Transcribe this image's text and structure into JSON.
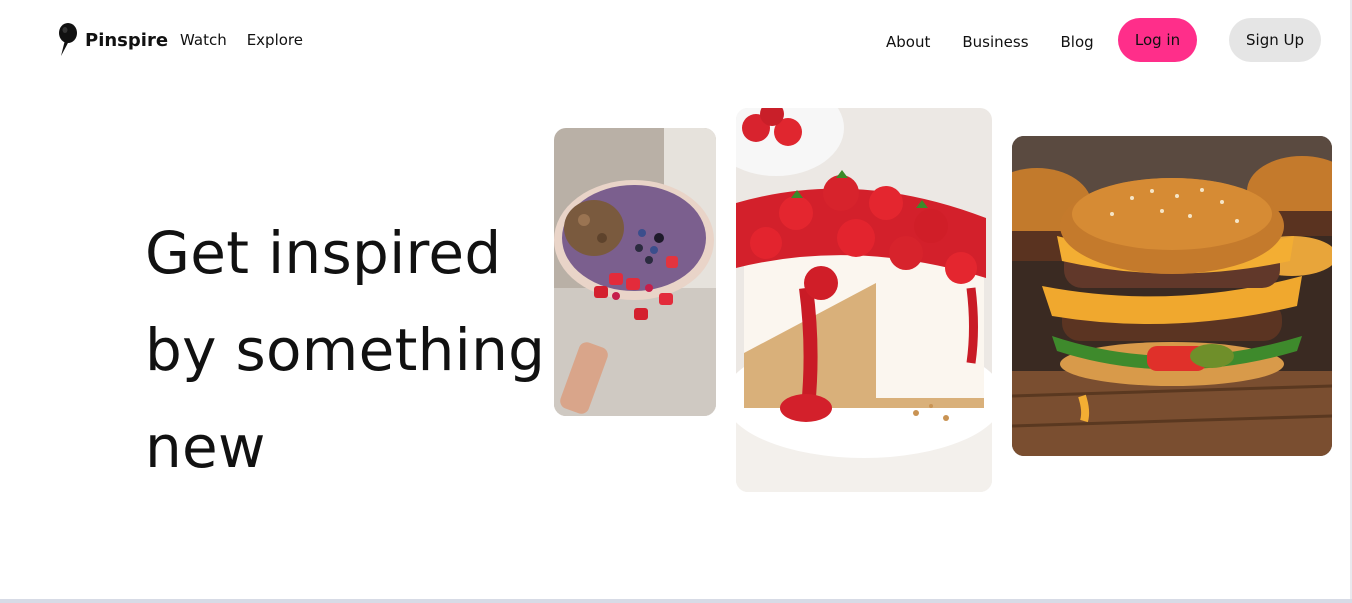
{
  "brand": {
    "name": "Pinspire",
    "icon": "pin-icon"
  },
  "nav": {
    "left": [
      "Watch",
      "Explore"
    ],
    "right": [
      "About",
      "Business",
      "Blog"
    ]
  },
  "auth": {
    "login_label": "Log in",
    "signup_label": "Sign Up"
  },
  "hero": {
    "lines": [
      "Get inspired",
      "by something",
      "new"
    ]
  },
  "images": [
    {
      "subject": "acai-bowl-with-berries"
    },
    {
      "subject": "strawberry-cheesecake"
    },
    {
      "subject": "double-cheeseburger"
    }
  ],
  "colors": {
    "login_bg": "#ff2e8a",
    "signup_bg": "#e5e5e5",
    "text": "#111111",
    "background": "#ffffff"
  }
}
